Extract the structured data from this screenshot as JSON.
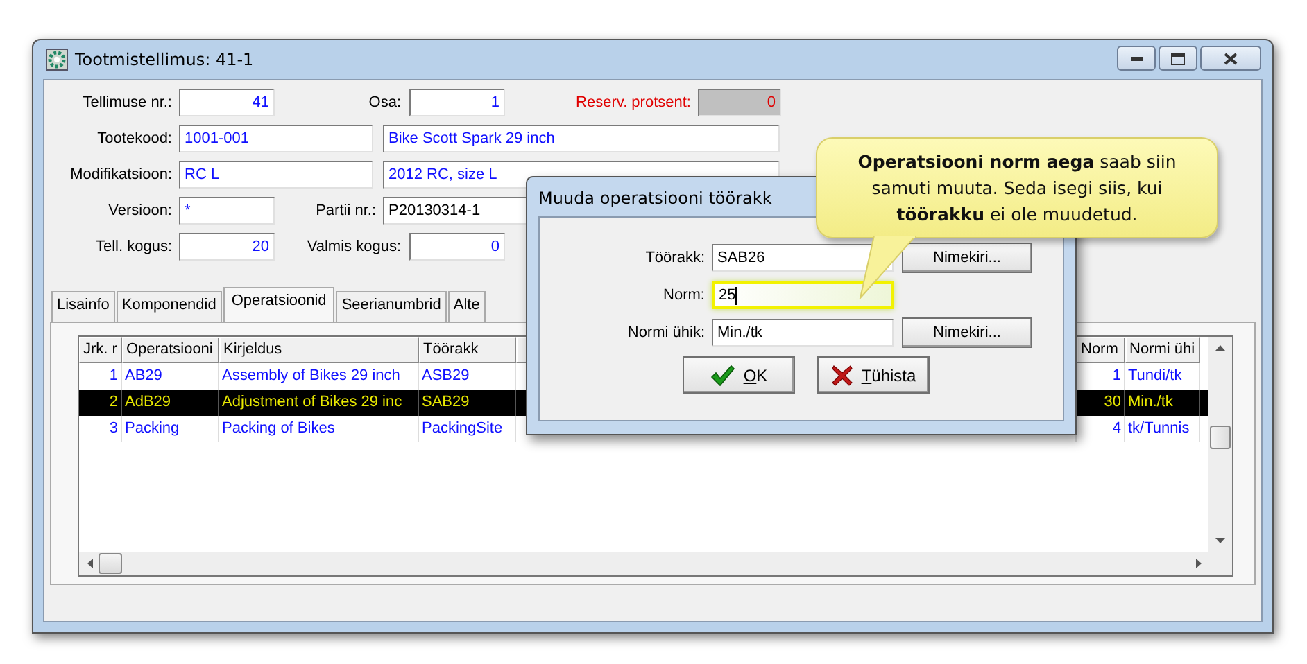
{
  "window": {
    "title": "Tootmistellimus: 41-1"
  },
  "form": {
    "order_no": {
      "label": "Tellimuse nr.:",
      "value": "41"
    },
    "part": {
      "label": "Osa:",
      "value": "1"
    },
    "reserve": {
      "label": "Reserv. protsent:",
      "value": "0",
      "disabled": true
    },
    "product_code": {
      "label": "Tootekood:",
      "value": "1001-001"
    },
    "product_name": {
      "value": "Bike Scott Spark 29 inch"
    },
    "modification": {
      "label": "Modifikatsioon:",
      "value": "RC L"
    },
    "modification_name": {
      "value": "2012 RC, size L"
    },
    "version": {
      "label": "Versioon:",
      "value": "*"
    },
    "batch": {
      "label": "Partii nr.:",
      "value": "P20130314-1"
    },
    "ordered_qty": {
      "label": "Tell. kogus:",
      "value": "20"
    },
    "finished_qty": {
      "label": "Valmis kogus:",
      "value": "0"
    }
  },
  "tabs": [
    {
      "label": "Lisainfo",
      "selected": false
    },
    {
      "label": "Komponendid",
      "selected": false
    },
    {
      "label": "Operatsioonid",
      "selected": true
    },
    {
      "label": "Seerianumbrid",
      "selected": false
    },
    {
      "label": "Alte",
      "selected": false
    }
  ],
  "table": {
    "columns": [
      {
        "label": "Jrk. r"
      },
      {
        "label": "Operatsiooni"
      },
      {
        "label": "Kirjeldus"
      },
      {
        "label": "Töörakk"
      },
      {
        "label": "Norm"
      },
      {
        "label": "Normi ühi"
      }
    ],
    "rows": [
      {
        "selected": false,
        "cells": [
          "1",
          "AB29",
          "Assembly of Bikes 29 inch",
          "ASB29",
          "1",
          "Tundi/tk"
        ]
      },
      {
        "selected": true,
        "cells": [
          "2",
          "AdB29",
          "Adjustment of Bikes 29 inc",
          "SAB29",
          "30",
          "Min./tk"
        ]
      },
      {
        "selected": false,
        "cells": [
          "3",
          "Packing",
          "Packing of Bikes",
          "PackingSite",
          "4",
          "tk/Tunnis"
        ]
      }
    ]
  },
  "dialog": {
    "title": "Muuda operatsiooni töörakk",
    "fields": [
      {
        "label": "Töörakk:",
        "value": "SAB26",
        "focused": false,
        "button": "Nimekiri..."
      },
      {
        "label": "Norm:",
        "value": "25",
        "focused": true
      },
      {
        "label": "Normi ühik:",
        "value": "Min./tk",
        "focused": false,
        "button": "Nimekiri..."
      }
    ],
    "buttons": [
      {
        "label": "OK",
        "kind": "ok"
      },
      {
        "label": "Tühista",
        "kind": "cancel"
      }
    ]
  },
  "callout": {
    "text": "**Operatsiooni norm aega** saab siin samuti muuta. Seda isegi siis, kui **töörakku** ei ole muudetud."
  }
}
